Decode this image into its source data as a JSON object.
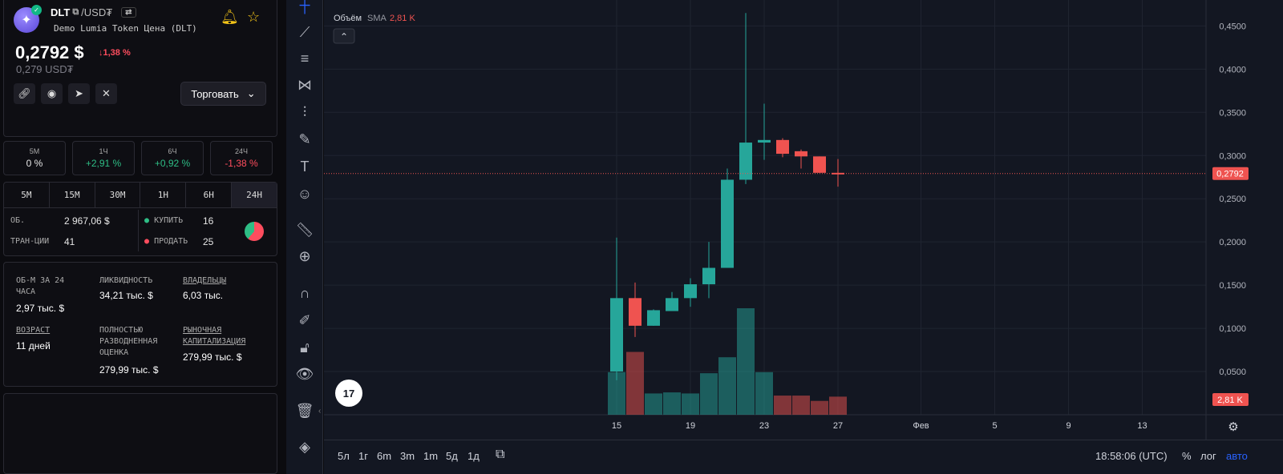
{
  "token": {
    "symbol": "DLT",
    "pair": "/USD₮",
    "name": "Demo Lumia Token Цена (DLT)",
    "price": "0,2792 $",
    "change": "↓1,38 %",
    "price_native": "0,279 USD₮",
    "trade_label": "Торговать"
  },
  "stats": [
    {
      "label": "5М",
      "value": "0 %",
      "color": "#e6e6e6"
    },
    {
      "label": "1Ч",
      "value": "+2,91 %",
      "color": "#2ebd85"
    },
    {
      "label": "6Ч",
      "value": "+0,92 %",
      "color": "#2ebd85"
    },
    {
      "label": "24Ч",
      "value": "-1,38 %",
      "color": "#ff4d5e"
    }
  ],
  "timeframes": [
    "5М",
    "15М",
    "30М",
    "1Н",
    "6Н",
    "24Н"
  ],
  "active_timeframe": "24Н",
  "txns": {
    "vol_label": "ОБ.",
    "vol_value": "2 967,06 $",
    "tx_label": "ТРАН-ЦИИ",
    "tx_value": "41",
    "buy_label": "КУПИТЬ",
    "buy_value": "16",
    "sell_label": "ПРОДАТЬ",
    "sell_value": "25"
  },
  "info": {
    "vol24_label": "ОБ-М ЗА 24 ЧАСА",
    "vol24_value": "2,97 тыс. $",
    "liq_label": "ЛИКВИДНОСТЬ",
    "liq_value": "34,21 тыс. $",
    "holders_label": "ВЛАДЕЛЬЦЫ",
    "holders_value": "6,03 тыс.",
    "age_label": "ВОЗРАСТ",
    "age_value": "11 дней",
    "fdv_label": "ПОЛНОСТЬЮ РАЗВОДНЕННАЯ ОЦЕНКА",
    "fdv_value": "279,99 тыс. $",
    "mcap_label": "РЫНОЧНАЯ КАПИТАЛИЗАЦИЯ",
    "mcap_value": "279,99 тыс. $"
  },
  "chart_header": {
    "volume_label": "Объём",
    "sma_label": "SMA",
    "sma_value": "2,81 K"
  },
  "bottom_bar": {
    "ranges": [
      "5л",
      "1г",
      "6m",
      "3m",
      "1m",
      "5д",
      "1д"
    ],
    "time": "18:58:06 (UTC)",
    "percent": "%",
    "log": "лог",
    "auto": "авто"
  },
  "colors": {
    "up": "#26a69a",
    "down": "#ef5350",
    "accent": "#2962ff"
  },
  "chart_data": {
    "type": "candlestick",
    "x_ticks": [
      "15",
      "19",
      "23",
      "27",
      "Фев",
      "5",
      "9",
      "13"
    ],
    "y_ticks": [
      "0,0500",
      "0,1000",
      "0,1500",
      "0,2000",
      "0,2500",
      "0,3000",
      "0,3500",
      "0,4000",
      "0,4500"
    ],
    "ylim": [
      0.0,
      0.48
    ],
    "last_price": "0,2792",
    "last_price_value": 0.2792,
    "volume_label": "2,81 K",
    "candles": [
      {
        "day": 15,
        "o": 0.05,
        "h": 0.205,
        "l": 0.04,
        "c": 0.135
      },
      {
        "day": 16,
        "o": 0.135,
        "h": 0.153,
        "l": 0.09,
        "c": 0.103
      },
      {
        "day": 17,
        "o": 0.103,
        "h": 0.122,
        "l": 0.103,
        "c": 0.121
      },
      {
        "day": 18,
        "o": 0.12,
        "h": 0.142,
        "l": 0.12,
        "c": 0.135
      },
      {
        "day": 19,
        "o": 0.135,
        "h": 0.158,
        "l": 0.125,
        "c": 0.151
      },
      {
        "day": 20,
        "o": 0.151,
        "h": 0.2,
        "l": 0.135,
        "c": 0.17
      },
      {
        "day": 21,
        "o": 0.17,
        "h": 0.285,
        "l": 0.17,
        "c": 0.272
      },
      {
        "day": 22,
        "o": 0.272,
        "h": 0.465,
        "l": 0.267,
        "c": 0.315
      },
      {
        "day": 23,
        "o": 0.315,
        "h": 0.36,
        "l": 0.295,
        "c": 0.318
      },
      {
        "day": 24,
        "o": 0.318,
        "h": 0.32,
        "l": 0.298,
        "c": 0.302
      },
      {
        "day": 25,
        "o": 0.305,
        "h": 0.307,
        "l": 0.285,
        "c": 0.299
      },
      {
        "day": 26,
        "o": 0.299,
        "h": 0.299,
        "l": 0.28,
        "c": 0.28
      },
      {
        "day": 27,
        "o": 0.28,
        "h": 0.296,
        "l": 0.264,
        "c": 0.279
      }
    ],
    "volumes": [
      {
        "day": 15,
        "v": 0.4,
        "dir": "up"
      },
      {
        "day": 16,
        "v": 0.59,
        "dir": "down"
      },
      {
        "day": 17,
        "v": 0.2,
        "dir": "up"
      },
      {
        "day": 18,
        "v": 0.21,
        "dir": "up"
      },
      {
        "day": 19,
        "v": 0.2,
        "dir": "up"
      },
      {
        "day": 20,
        "v": 0.39,
        "dir": "up"
      },
      {
        "day": 21,
        "v": 0.54,
        "dir": "up"
      },
      {
        "day": 22,
        "v": 1.0,
        "dir": "up"
      },
      {
        "day": 23,
        "v": 0.4,
        "dir": "up"
      },
      {
        "day": 24,
        "v": 0.18,
        "dir": "down"
      },
      {
        "day": 25,
        "v": 0.18,
        "dir": "down"
      },
      {
        "day": 26,
        "v": 0.13,
        "dir": "down"
      },
      {
        "day": 27,
        "v": 0.17,
        "dir": "down"
      }
    ]
  }
}
